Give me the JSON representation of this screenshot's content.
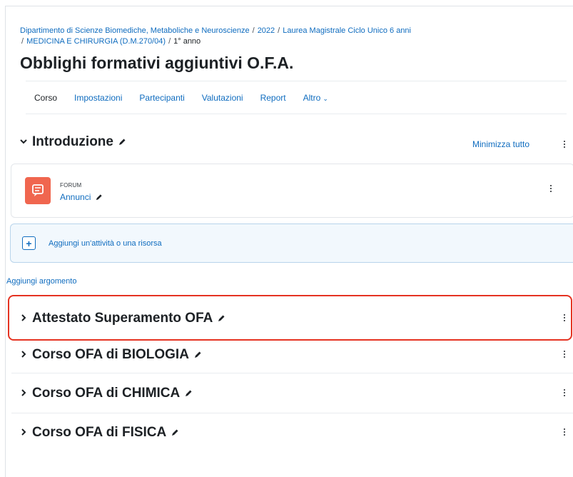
{
  "breadcrumb": {
    "items": [
      "Dipartimento di Scienze Biomediche, Metaboliche e Neuroscienze",
      "2022",
      "Laurea Magistrale Ciclo Unico 6 anni",
      "MEDICINA E CHIRURGIA (D.M.270/04)",
      "1° anno"
    ],
    "separator": "/"
  },
  "page_title": "Obblighi formativi aggiuntivi O.F.A.",
  "nav": {
    "tabs": [
      "Corso",
      "Impostazioni",
      "Partecipanti",
      "Valutazioni",
      "Report",
      "Altro"
    ],
    "active": "Corso",
    "more_chevron": "⌄"
  },
  "sections": {
    "intro": {
      "title": "Introduzione",
      "toggle_icon": "expanded-chevron"
    },
    "minimize_all": "Minimizza tutto",
    "forum": {
      "type": "FORUM",
      "name": "Annunci",
      "icon": "forum-icon",
      "icon_color": "#f0664f"
    },
    "add_activity": "Aggiungi un'attività o una risorsa",
    "add_topic": "Aggiungi argomento",
    "collapsed": [
      {
        "title": "Attestato Superamento OFA",
        "highlighted": true
      },
      {
        "title": "Corso OFA di BIOLOGIA"
      },
      {
        "title": "Corso OFA di CHIMICA"
      },
      {
        "title": "Corso OFA di FISICA"
      }
    ]
  },
  "colors": {
    "link": "#0f6cbf",
    "highlight_border": "#e53322",
    "text": "#1d2125"
  }
}
